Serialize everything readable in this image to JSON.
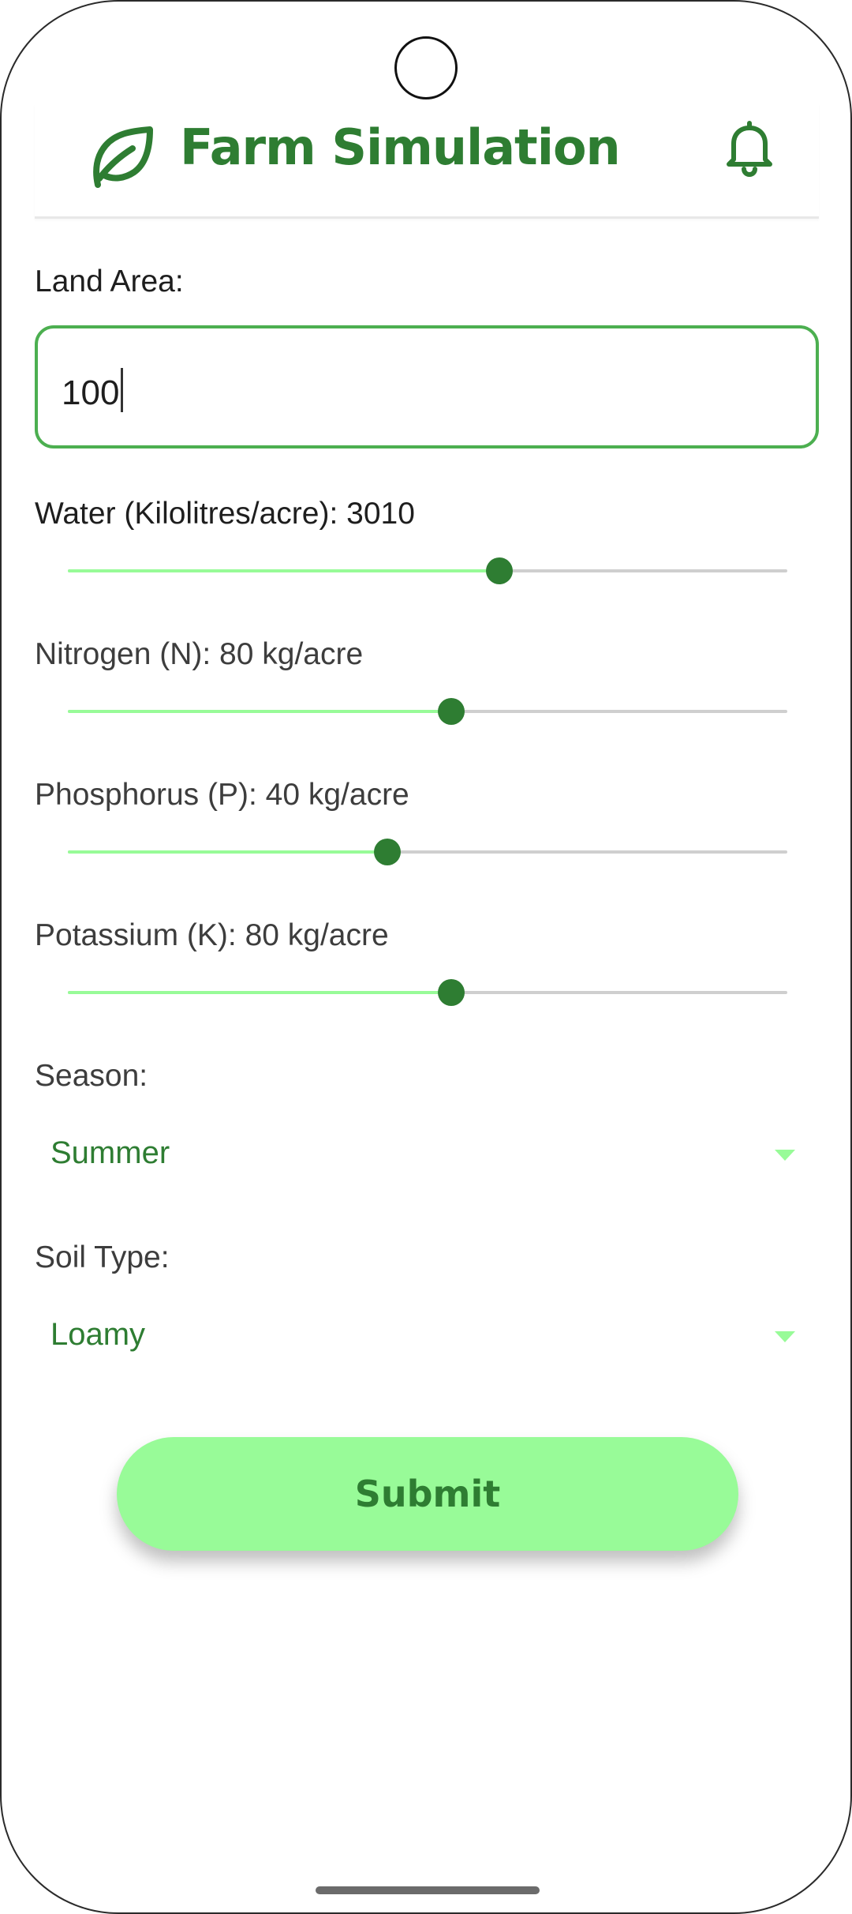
{
  "header": {
    "title": "Farm Simulation",
    "logo_icon": "leaf-icon",
    "notification_icon": "bell-icon",
    "accent_color": "#2e7d32"
  },
  "land_area": {
    "label": "Land Area:",
    "value": "100"
  },
  "sliders": [
    {
      "label": "Water (Kilolitres/acre): 3010",
      "fraction": 0.6
    },
    {
      "label": "Nitrogen (N): 80 kg/acre",
      "fraction": 0.533
    },
    {
      "label": "Phosphorus (P): 40 kg/acre",
      "fraction": 0.444
    },
    {
      "label": "Potassium (K): 80 kg/acre",
      "fraction": 0.533
    }
  ],
  "season": {
    "label": "Season:",
    "selected": "Summer"
  },
  "soil_type": {
    "label": "Soil Type:",
    "selected": "Loamy"
  },
  "submit": {
    "label": "Submit",
    "color": "#98fb98"
  }
}
